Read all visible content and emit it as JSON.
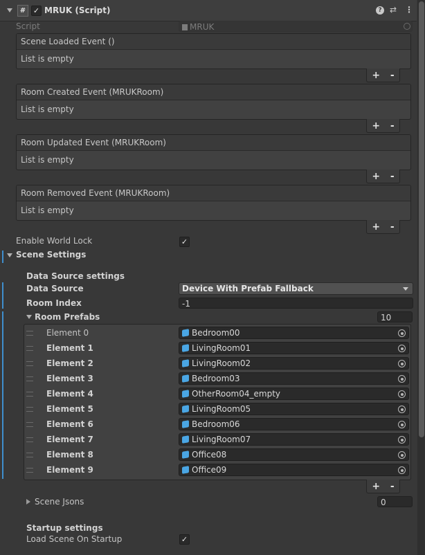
{
  "header": {
    "title": "MRUK (Script)",
    "icon": "#",
    "help_icon": "?",
    "settings_icon": "⇄",
    "menu_icon": "⋮",
    "enabled_mark": "✓"
  },
  "script_field": {
    "label": "Script",
    "value": "MRUK"
  },
  "events": [
    {
      "header": "Scene Loaded Event ()",
      "body": "List is empty"
    },
    {
      "header": "Room Created Event (MRUKRoom)",
      "body": "List is empty"
    },
    {
      "header": "Room Updated Event (MRUKRoom)",
      "body": "List is empty"
    },
    {
      "header": "Room Removed Event (MRUKRoom)",
      "body": "List is empty"
    }
  ],
  "buttons": {
    "plus": "+",
    "minus": "-"
  },
  "enable_world_lock": {
    "label": "Enable World Lock",
    "checked_mark": "✓"
  },
  "scene_settings": {
    "label": "Scene Settings",
    "data_source_settings": "Data Source settings",
    "data_source": {
      "label": "Data Source",
      "value": "Device With Prefab Fallback"
    },
    "room_index": {
      "label": "Room Index",
      "value": "-1"
    },
    "room_prefabs": {
      "label": "Room Prefabs",
      "count": "10",
      "elements": [
        {
          "label": "Element 0",
          "value": "Bedroom00"
        },
        {
          "label": "Element 1",
          "value": "LivingRoom01"
        },
        {
          "label": "Element 2",
          "value": "LivingRoom02"
        },
        {
          "label": "Element 3",
          "value": "Bedroom03"
        },
        {
          "label": "Element 4",
          "value": "OtherRoom04_empty"
        },
        {
          "label": "Element 5",
          "value": "LivingRoom05"
        },
        {
          "label": "Element 6",
          "value": "Bedroom06"
        },
        {
          "label": "Element 7",
          "value": "LivingRoom07"
        },
        {
          "label": "Element 8",
          "value": "Office08"
        },
        {
          "label": "Element 9",
          "value": "Office09"
        }
      ]
    },
    "scene_jsons": {
      "label": "Scene Jsons",
      "count": "0"
    },
    "startup_settings": "Startup settings",
    "load_scene_on_startup": {
      "label": "Load Scene On Startup",
      "checked_mark": "✓"
    }
  }
}
